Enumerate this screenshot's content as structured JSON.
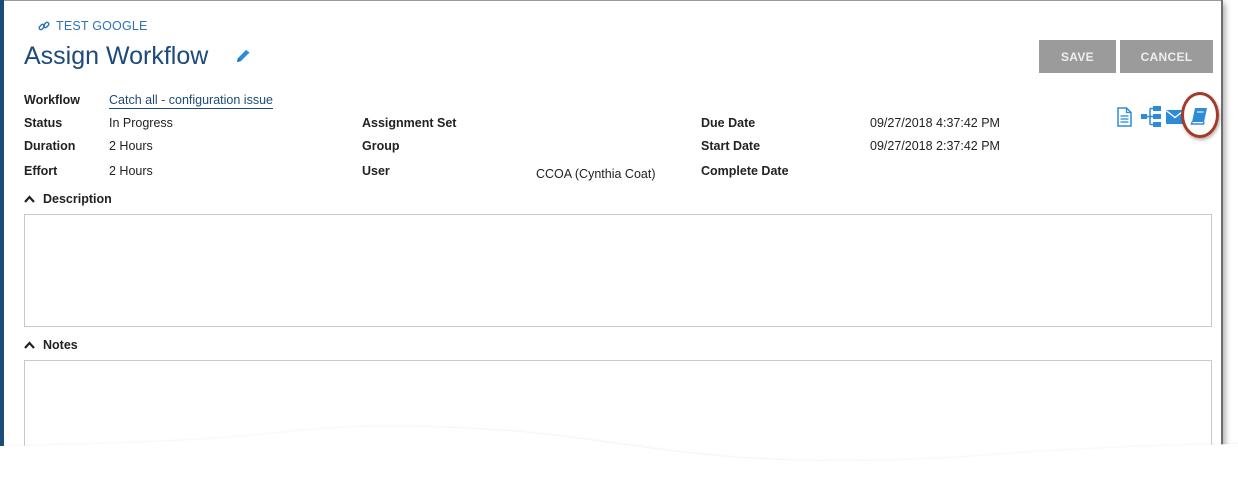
{
  "breadcrumb": {
    "label": "TEST GOOGLE"
  },
  "page": {
    "title": "Assign Workflow"
  },
  "toolbar": {
    "save_label": "SAVE",
    "cancel_label": "CANCEL"
  },
  "fields": {
    "workflow_label": "Workflow",
    "workflow_value": "Catch all - configuration issue",
    "status_label": "Status",
    "status_value": "In Progress",
    "duration_label": "Duration",
    "duration_value": "2 Hours",
    "effort_label": "Effort",
    "effort_value": "2 Hours",
    "assignment_set_label": "Assignment Set",
    "group_label": "Group",
    "user_label": "User",
    "user_value": "CCOA (Cynthia Coat)",
    "due_date_label": "Due Date",
    "due_date_value": "09/27/2018 4:37:42 PM",
    "start_date_label": "Start Date",
    "start_date_value": "09/27/2018 2:37:42 PM",
    "complete_date_label": "Complete Date"
  },
  "sections": {
    "description_label": "Description",
    "notes_label": "Notes"
  },
  "icons": [
    "link-icon",
    "pencil-icon",
    "document-icon",
    "workflow-tree-icon",
    "email-icon",
    "book-icon",
    "chevron-up-icon"
  ],
  "colors": {
    "accent": "#1c4a7a",
    "link": "#2e75b6",
    "icon": "#2e8bd8",
    "button": "#9b9b9b",
    "highlight_ring": "#a33a2a"
  }
}
